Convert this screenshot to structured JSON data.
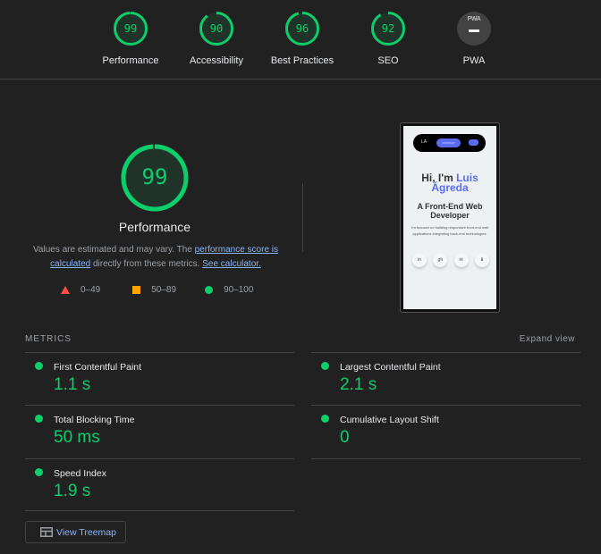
{
  "header": {
    "categories": [
      {
        "label": "Performance",
        "score": "99",
        "value": 0.99,
        "type": "gauge"
      },
      {
        "label": "Accessibility",
        "score": "90",
        "value": 0.9,
        "type": "gauge"
      },
      {
        "label": "Best Practices",
        "score": "96",
        "value": 0.96,
        "type": "gauge"
      },
      {
        "label": "SEO",
        "score": "92",
        "value": 0.92,
        "type": "gauge"
      },
      {
        "label": "PWA",
        "score": "",
        "type": "pwa-badge",
        "badge_text": "PWA"
      }
    ]
  },
  "performance": {
    "score": "99",
    "value": 0.99,
    "title": "Performance",
    "description_prefix": "Values are estimated and may vary. The ",
    "score_link": "performance score is calculated",
    "description_middle": " directly from these metrics. ",
    "calculator_link": "See calculator.",
    "legend": [
      {
        "shape": "triangle",
        "range": "0–49",
        "color": "#ff4e42"
      },
      {
        "shape": "square",
        "range": "50–89",
        "color": "#ffa400"
      },
      {
        "shape": "circle",
        "range": "90–100",
        "color": "#0cce6b"
      }
    ]
  },
  "screenshot": {
    "nav_logo": "LA",
    "nav_button": "CONTACT",
    "heading_prefix": "Hi, I'm ",
    "heading_name": "Luis Ágreda",
    "subheading": "A Front-End Web Developer",
    "paragraph": "I'm focused on building responsive front-end web applications integrating back-end technologies.",
    "socials": [
      "in",
      "gh",
      "✉",
      "⬇"
    ]
  },
  "metrics": {
    "header": "METRICS",
    "expand_label": "Expand view",
    "items": [
      {
        "title": "First Contentful Paint",
        "value": "1.1 s",
        "status": "pass"
      },
      {
        "title": "Largest Contentful Paint",
        "value": "2.1 s",
        "status": "pass"
      },
      {
        "title": "Total Blocking Time",
        "value": "50 ms",
        "status": "pass"
      },
      {
        "title": "Cumulative Layout Shift",
        "value": "0",
        "status": "pass"
      },
      {
        "title": "Speed Index",
        "value": "1.9 s",
        "status": "pass"
      }
    ]
  },
  "treemap_button": {
    "label": "View Treemap",
    "icon": "treemap-icon"
  },
  "colors": {
    "pass": "#0cce6b",
    "average": "#ffa400",
    "fail": "#ff4e42",
    "link": "#8ab4f8",
    "background": "#212121"
  }
}
